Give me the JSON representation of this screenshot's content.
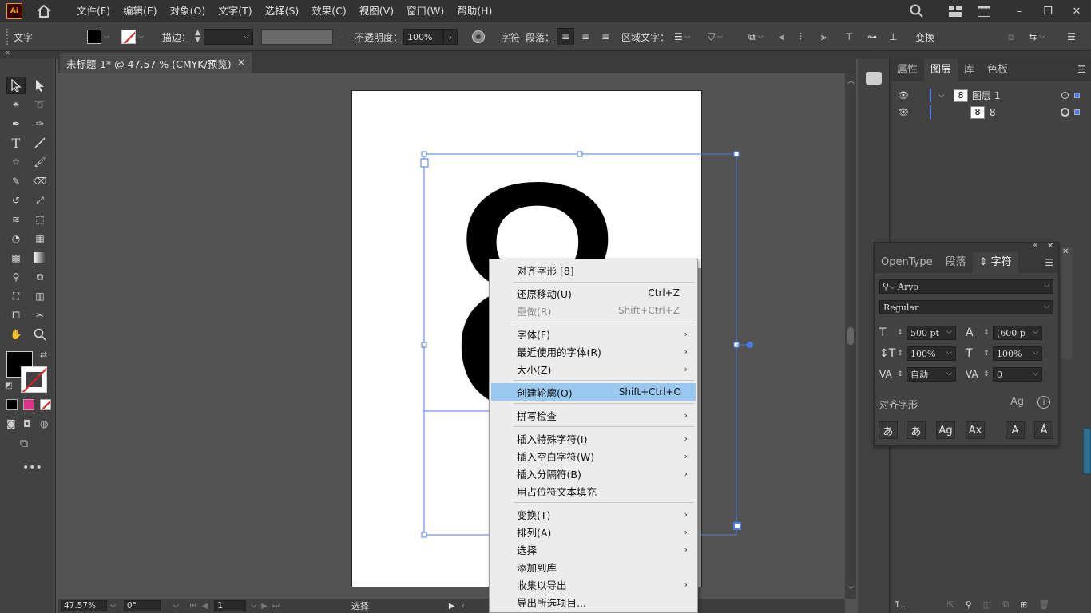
{
  "app": {
    "logo_text": "Ai"
  },
  "menubar": {
    "items": [
      "文件(F)",
      "编辑(E)",
      "对象(O)",
      "文字(T)",
      "选择(S)",
      "效果(C)",
      "视图(V)",
      "窗口(W)",
      "帮助(H)"
    ]
  },
  "controlbar": {
    "tool_label": "文字",
    "stroke_label": "描边：",
    "opacity_label": "不透明度：",
    "opacity_value": "100%",
    "char_label": "字符",
    "para_label": "段落：",
    "area_text_label": "区域文字：",
    "transform_label": "变换"
  },
  "document": {
    "tab_title": "未标题-1* @ 47.57 % (CMYK/预览)",
    "close": "×",
    "glyph": "8"
  },
  "statusbar": {
    "zoom": "47.57%",
    "rotation": "0°",
    "artboard_num": "1",
    "mode": "选择"
  },
  "layers_panel": {
    "tabs": [
      "属性",
      "图层",
      "库",
      "色板"
    ],
    "active_tab": "图层",
    "layers": [
      {
        "name": "图层 1",
        "thumb": "8"
      },
      {
        "name": "8",
        "thumb": "8"
      }
    ],
    "footer_count": "1..."
  },
  "character_panel": {
    "tabs": [
      "OpenType",
      "段落",
      "字符"
    ],
    "active_tab": "字符",
    "font_family": "Arvo",
    "font_style": "Regular",
    "font_size": "500 pt",
    "leading": "(600 p",
    "vert_scale": "100%",
    "horiz_scale": "100%",
    "kerning": "自动",
    "tracking": "0",
    "align_glyphs_label": "对齐字形"
  },
  "context_menu": {
    "items": [
      {
        "label": "对齐字形 [8]",
        "shortcut": "",
        "submenu": false,
        "disabled": false,
        "highlighted": false
      },
      {
        "label": "还原移动(U)",
        "shortcut": "Ctrl+Z",
        "submenu": false,
        "disabled": false,
        "highlighted": false
      },
      {
        "label": "重做(R)",
        "shortcut": "Shift+Ctrl+Z",
        "submenu": false,
        "disabled": true,
        "highlighted": false
      },
      {
        "label": "字体(F)",
        "shortcut": "",
        "submenu": true,
        "disabled": false,
        "highlighted": false
      },
      {
        "label": "最近使用的字体(R)",
        "shortcut": "",
        "submenu": true,
        "disabled": false,
        "highlighted": false
      },
      {
        "label": "大小(Z)",
        "shortcut": "",
        "submenu": true,
        "disabled": false,
        "highlighted": false
      },
      {
        "label": "创建轮廓(O)",
        "shortcut": "Shift+Ctrl+O",
        "submenu": false,
        "disabled": false,
        "highlighted": true
      },
      {
        "label": "拼写检查",
        "shortcut": "",
        "submenu": true,
        "disabled": false,
        "highlighted": false
      },
      {
        "label": "插入特殊字符(I)",
        "shortcut": "",
        "submenu": true,
        "disabled": false,
        "highlighted": false
      },
      {
        "label": "插入空白字符(W)",
        "shortcut": "",
        "submenu": true,
        "disabled": false,
        "highlighted": false
      },
      {
        "label": "插入分隔符(B)",
        "shortcut": "",
        "submenu": true,
        "disabled": false,
        "highlighted": false
      },
      {
        "label": "用占位符文本填充",
        "shortcut": "",
        "submenu": false,
        "disabled": false,
        "highlighted": false
      },
      {
        "label": "变换(T)",
        "shortcut": "",
        "submenu": true,
        "disabled": false,
        "highlighted": false
      },
      {
        "label": "排列(A)",
        "shortcut": "",
        "submenu": true,
        "disabled": false,
        "highlighted": false
      },
      {
        "label": "选择",
        "shortcut": "",
        "submenu": true,
        "disabled": false,
        "highlighted": false
      },
      {
        "label": "添加到库",
        "shortcut": "",
        "submenu": false,
        "disabled": false,
        "highlighted": false
      },
      {
        "label": "收集以导出",
        "shortcut": "",
        "submenu": true,
        "disabled": false,
        "highlighted": false
      },
      {
        "label": "导出所选项目...",
        "shortcut": "",
        "submenu": false,
        "disabled": false,
        "highlighted": false
      }
    ]
  },
  "colors": {
    "selection_blue": "#4a7ee8",
    "menu_highlight": "#99c8f0",
    "app_bg": "#535353"
  }
}
